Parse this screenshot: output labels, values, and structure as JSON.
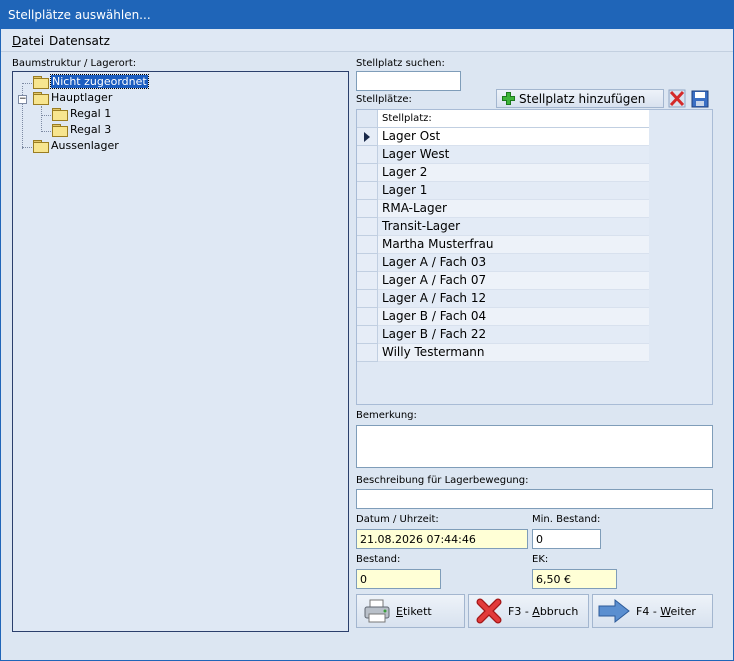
{
  "window": {
    "title": "Stellplätze auswählen..."
  },
  "menu": {
    "file_pre": "D",
    "file_rest": "atei",
    "record": "Datensatz"
  },
  "tree": {
    "label": "Baumstruktur / Lagerort:",
    "nodes": {
      "unassigned": "Nicht zugeordnet",
      "main": "Hauptlager",
      "shelf1": "Regal 1",
      "shelf3": "Regal 3",
      "outer": "Aussenlager"
    },
    "collapse_symbol": "−"
  },
  "search": {
    "label": "Stellplatz suchen:",
    "value": ""
  },
  "locations": {
    "label": "Stellplätze:",
    "add_button": "Stellplatz hinzufügen",
    "column_header": "Stellplatz:",
    "rows": [
      "Lager Ost",
      "Lager West",
      "Lager 2",
      "Lager 1",
      "RMA-Lager",
      "Transit-Lager",
      "Martha Musterfrau",
      "Lager A / Fach 03",
      "Lager A / Fach 07",
      "Lager A / Fach 12",
      "Lager B / Fach 04",
      "Lager B / Fach 22",
      "Willy Testermann"
    ]
  },
  "remark": {
    "label": "Bemerkung:",
    "value": ""
  },
  "movement": {
    "label": "Beschreibung für Lagerbewegung:",
    "value": ""
  },
  "datetime": {
    "label": "Datum / Uhrzeit:",
    "value": "21.08.2026 07:44:46"
  },
  "min_stock": {
    "label": "Min. Bestand:",
    "value": "0"
  },
  "stock": {
    "label": "Bestand:",
    "value": "0"
  },
  "ek": {
    "label": "EK:",
    "value": "6,50 €"
  },
  "buttons": {
    "label_pre": "E",
    "label_rest": "tikett",
    "cancel_pre": "F3 - ",
    "cancel_u": "A",
    "cancel_rest": "bbruch",
    "next_pre": "F4 - ",
    "next_u": "W",
    "next_rest": "eiter"
  }
}
